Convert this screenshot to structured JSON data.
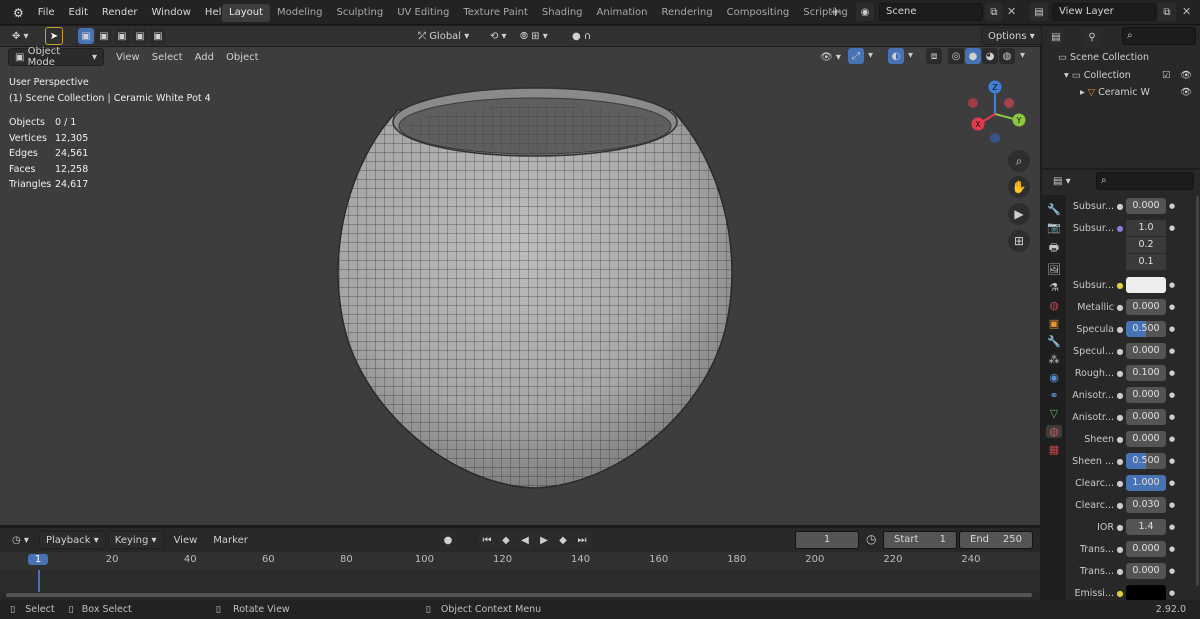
{
  "menu": {
    "items": [
      "File",
      "Edit",
      "Render",
      "Window",
      "Help"
    ]
  },
  "workspaces": [
    "Layout",
    "Modeling",
    "Sculpting",
    "UV Editing",
    "Texture Paint",
    "Shading",
    "Animation",
    "Rendering",
    "Compositing",
    "Scripting"
  ],
  "active_workspace": "Layout",
  "scene": {
    "name": "Scene",
    "view_layer": "View Layer"
  },
  "toolbar": {
    "transform_orientation": "Global",
    "options_label": "Options"
  },
  "viewport_header": {
    "mode": "Object Mode",
    "menus": [
      "View",
      "Select",
      "Add",
      "Object"
    ]
  },
  "overlay_info": {
    "perspective": "User Perspective",
    "collection_line": "(1) Scene Collection | Ceramic White Pot 4",
    "stats": [
      {
        "label": "Objects",
        "value": "0 / 1"
      },
      {
        "label": "Vertices",
        "value": "12,305"
      },
      {
        "label": "Edges",
        "value": "24,561"
      },
      {
        "label": "Faces",
        "value": "12,258"
      },
      {
        "label": "Triangles",
        "value": "24,617"
      }
    ]
  },
  "gizmo": {
    "z": "Z",
    "y": "Y",
    "x": "X",
    "colors": {
      "x": "#e7394d",
      "y": "#8bc63f",
      "z": "#3f7fd8"
    }
  },
  "outliner": {
    "root": "Scene Collection",
    "collection": "Collection",
    "object": "Ceramic W"
  },
  "properties": {
    "rows": [
      {
        "label": "Subsur...",
        "value": "0.000",
        "style": ""
      },
      {
        "label": "Subsur...",
        "value": "1.0",
        "style": ""
      },
      {
        "label": "",
        "value": "0.2",
        "style": ""
      },
      {
        "label": "",
        "value": "0.1",
        "style": ""
      },
      {
        "label": "Subsur...",
        "value": "",
        "style": "light"
      },
      {
        "label": "Metallic",
        "value": "0.000",
        "style": ""
      },
      {
        "label": "Specula",
        "value": "0.500",
        "style": "blue"
      },
      {
        "label": "Specul...",
        "value": "0.000",
        "style": ""
      },
      {
        "label": "Rough...",
        "value": "0.100",
        "style": ""
      },
      {
        "label": "Anisotr...",
        "value": "0.000",
        "style": ""
      },
      {
        "label": "Anisotr...",
        "value": "0.000",
        "style": ""
      },
      {
        "label": "Sheen",
        "value": "0.000",
        "style": ""
      },
      {
        "label": "Sheen ...",
        "value": "0.500",
        "style": "blue"
      },
      {
        "label": "Clearc...",
        "value": "1.000",
        "style": "full"
      },
      {
        "label": "Clearc...",
        "value": "0.030",
        "style": ""
      },
      {
        "label": "IOR",
        "value": "1.4",
        "style": ""
      },
      {
        "label": "Trans...",
        "value": "0.000",
        "style": ""
      },
      {
        "label": "Trans...",
        "value": "0.000",
        "style": ""
      },
      {
        "label": "Emissi...",
        "value": "",
        "style": "black"
      }
    ]
  },
  "timeline": {
    "menus": [
      "Playback",
      "Keying",
      "View",
      "Marker"
    ],
    "current_frame": "1",
    "start_label": "Start",
    "start": "1",
    "end_label": "End",
    "end": "250",
    "ticks": [
      "1",
      "20",
      "40",
      "60",
      "80",
      "100",
      "120",
      "140",
      "160",
      "180",
      "200",
      "220",
      "240"
    ]
  },
  "status": {
    "select": "Select",
    "box_select": "Box Select",
    "rotate": "Rotate View",
    "context": "Object Context Menu",
    "version": "2.92.0"
  }
}
